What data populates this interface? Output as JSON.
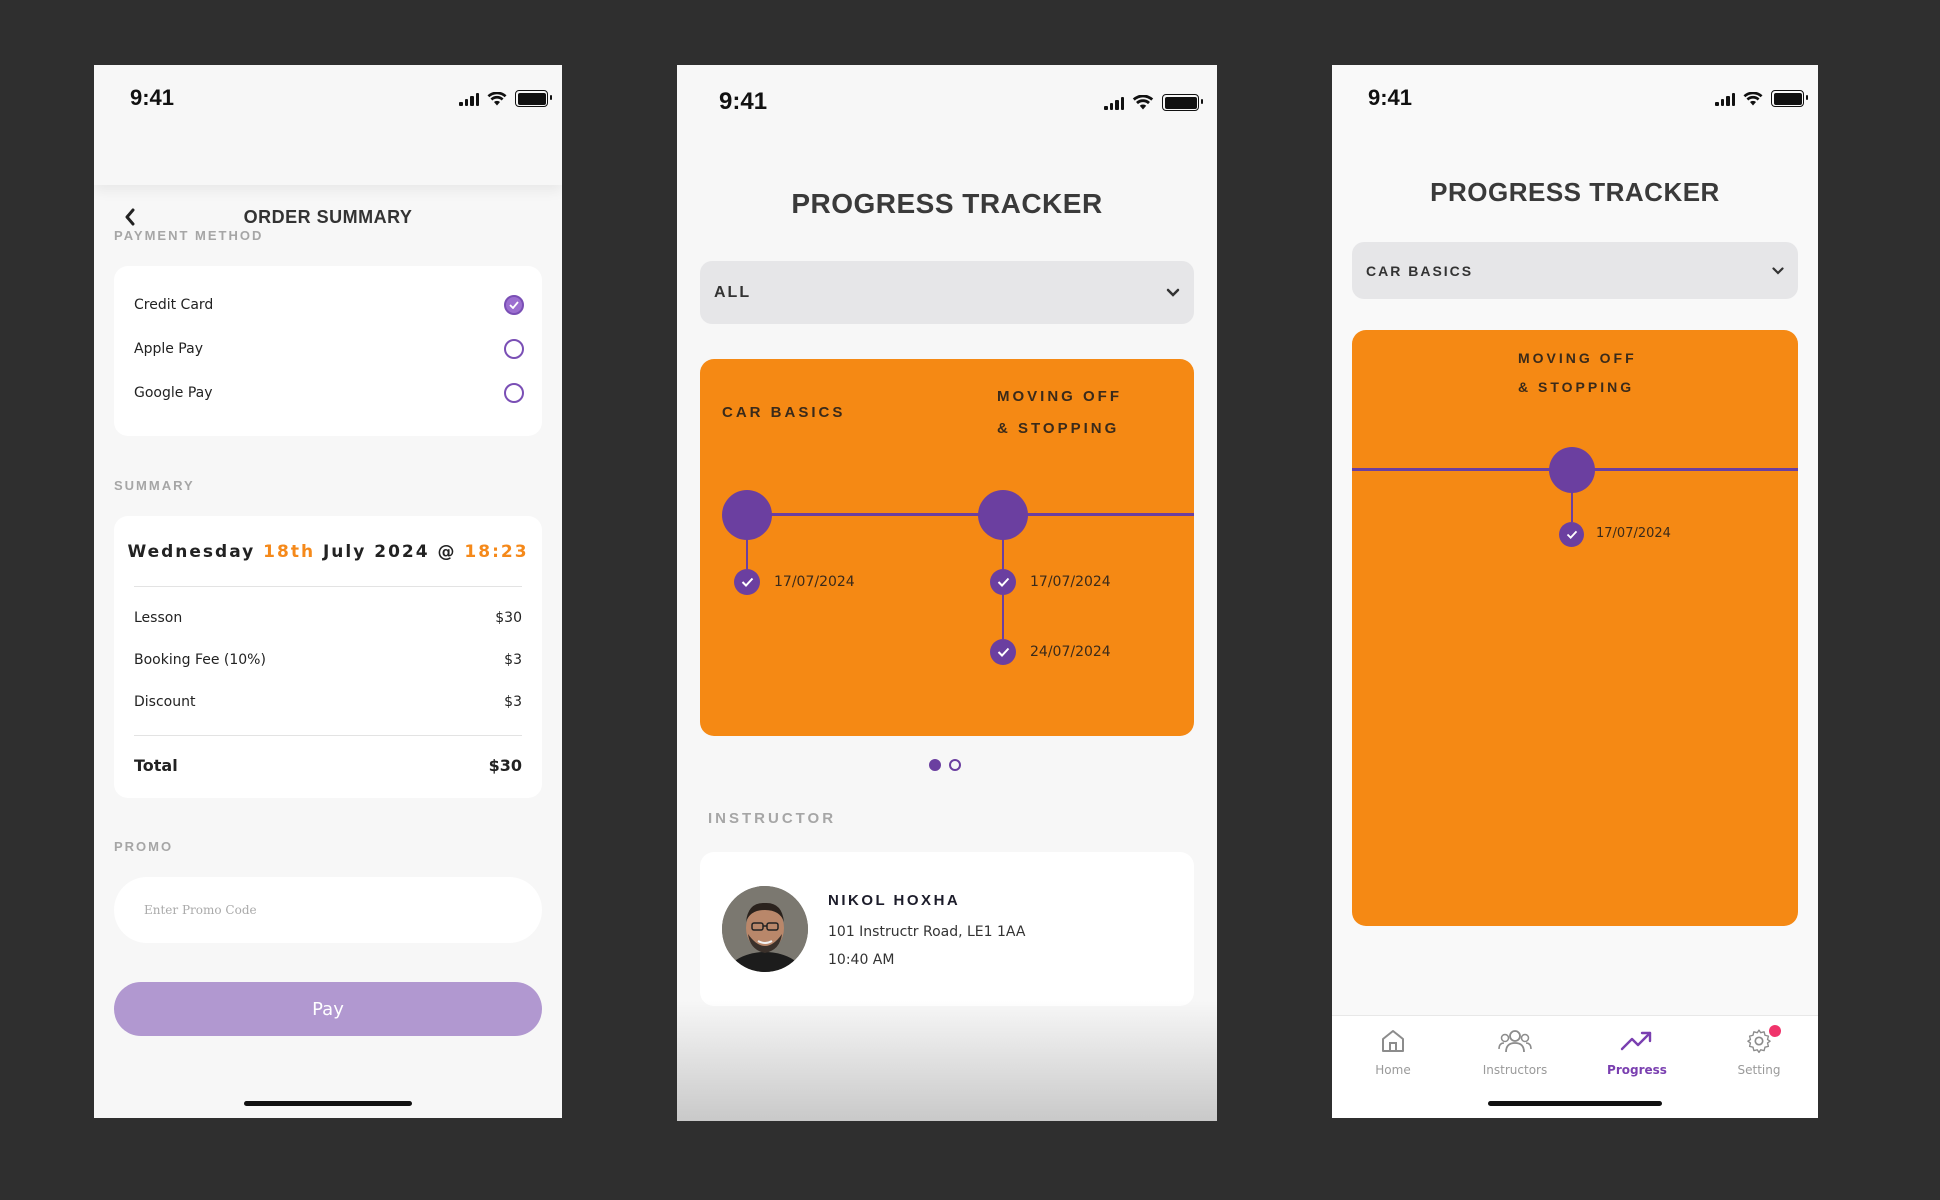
{
  "colors": {
    "background": "#2f2f2f",
    "accent_orange": "#f58914",
    "accent_purple": "#6b3fa0",
    "pay_button": "#b198d0",
    "notification_badge": "#f0336b"
  },
  "order_screen": {
    "status_time": "9:41",
    "title": "ORDER SUMMARY",
    "payment_label": "PAYMENT METHOD",
    "payment_methods": [
      {
        "label": "Credit Card",
        "selected": true
      },
      {
        "label": "Apple Pay",
        "selected": false
      },
      {
        "label": "Google Pay",
        "selected": false
      }
    ],
    "summary_label": "SUMMARY",
    "date": {
      "weekday": "Wednesday",
      "day": "18th",
      "month_year": "July 2024",
      "at": "@",
      "time": "18:23"
    },
    "line_items": [
      {
        "label": "Lesson",
        "amount": "$30"
      },
      {
        "label": "Booking Fee (10%)",
        "amount": "$3"
      },
      {
        "label": "Discount",
        "amount": "$3"
      }
    ],
    "total_label": "Total",
    "total_amount": "$30",
    "promo_label": "PROMO",
    "promo_placeholder": "Enter Promo Code",
    "pay_label": "Pay"
  },
  "tracker_screen": {
    "status_time": "9:41",
    "title": "PROGRESS TRACKER",
    "filter_value": "ALL",
    "stages": [
      {
        "name_line1": "CAR BASICS",
        "name_line2": "",
        "dates": [
          "17/07/2024"
        ]
      },
      {
        "name_line1": "MOVING OFF",
        "name_line2": "& STOPPING",
        "dates": [
          "17/07/2024",
          "24/07/2024"
        ]
      }
    ],
    "page_indicator": {
      "current": 1,
      "total": 2
    },
    "instructor_label": "INSTRUCTOR",
    "instructor": {
      "name": "NIKOL HOXHA",
      "address": "101 Instructr Road, LE1 1AA",
      "time": "10:40 AM"
    }
  },
  "tracker_detail_screen": {
    "status_time": "9:41",
    "title": "PROGRESS TRACKER",
    "filter_value": "CAR BASICS",
    "stage": {
      "name_line1": "MOVING OFF",
      "name_line2": "& STOPPING",
      "dates": [
        "17/07/2024"
      ]
    },
    "tabs": [
      {
        "label": "Home",
        "icon": "home-icon",
        "active": false
      },
      {
        "label": "Instructors",
        "icon": "users-icon",
        "active": false
      },
      {
        "label": "Progress",
        "icon": "trending-up-icon",
        "active": true
      },
      {
        "label": "Setting",
        "icon": "gear-icon",
        "active": false,
        "badge": true
      }
    ]
  }
}
